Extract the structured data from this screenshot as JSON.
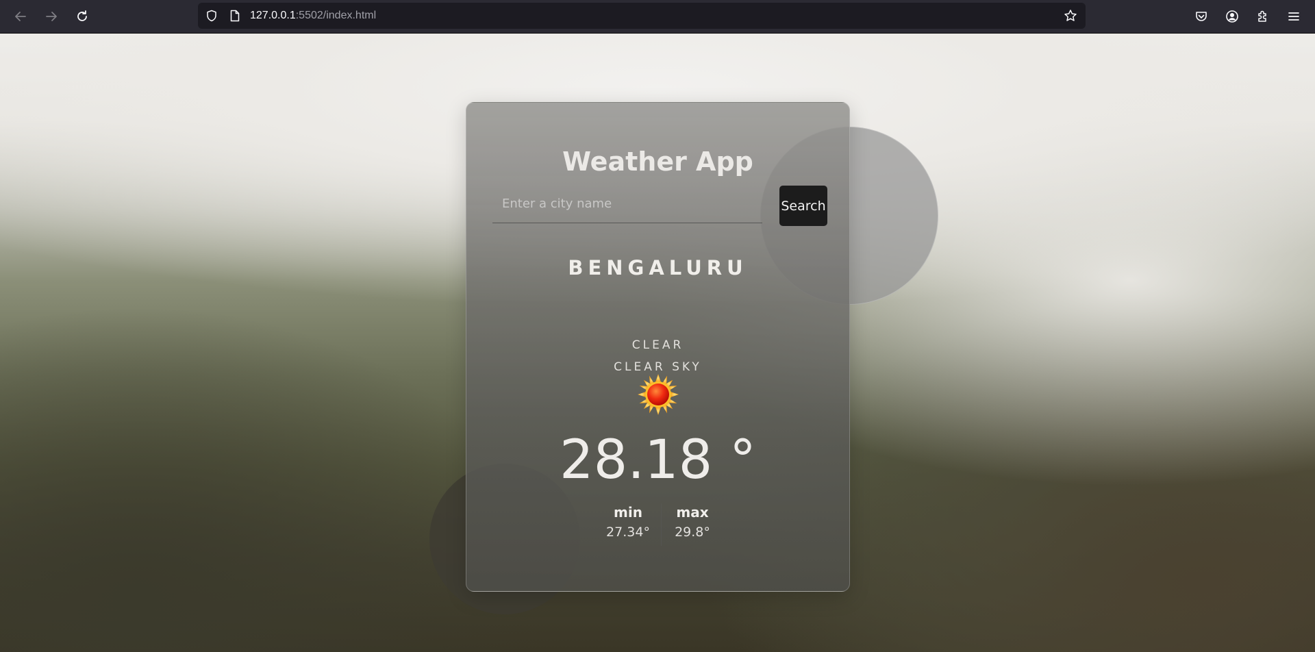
{
  "browser": {
    "url_host": "127.0.0.1",
    "url_rest": ":5502/index.html",
    "icons": [
      "back-icon",
      "forward-icon",
      "reload-icon",
      "shield-icon",
      "page-icon",
      "star-icon",
      "pocket-icon",
      "account-icon",
      "extensions-icon",
      "menu-icon"
    ]
  },
  "app": {
    "title": "Weather App",
    "search": {
      "placeholder": "Enter a city name",
      "value": "",
      "button_label": "Search"
    },
    "city": "BENGALURU",
    "condition": "CLEAR",
    "description": "CLEAR SKY",
    "icon": "sun-icon",
    "temperature": "28.18 °",
    "min_label": "min",
    "min_value": "27.34°",
    "max_label": "max",
    "max_value": "29.8°"
  },
  "colors": {
    "search_button": "#1c1c1c",
    "text": "#efedea"
  }
}
